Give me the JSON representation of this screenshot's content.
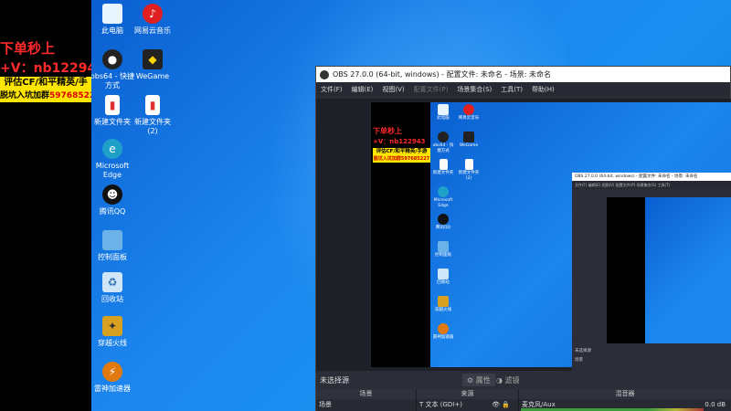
{
  "overlay": {
    "line1": "下单秒上",
    "line2": "+V：nb122943",
    "line3": "评估CF/和平精英/手游",
    "line4_prefix": "脱坑入坑加群",
    "line4_qq": "597685227"
  },
  "desktop_icons": [
    {
      "label": "此电脑",
      "icon": "pc-icon",
      "color": "#e8f4ff"
    },
    {
      "label": "网易云音乐",
      "icon": "netease-music-icon",
      "color": "#e02020"
    },
    {
      "label": "obs64 - 快捷方式",
      "icon": "obs-icon",
      "color": "#222"
    },
    {
      "label": "WeGame",
      "icon": "wegame-icon",
      "color": "#222"
    },
    {
      "label": "新建文件夹",
      "icon": "file-icon",
      "color": "#ffffff"
    },
    {
      "label": "新建文件夹(2)",
      "icon": "file-icon",
      "color": "#ffffff"
    },
    {
      "label": "Microsoft Edge",
      "icon": "edge-icon",
      "color": "#1fa0c8"
    },
    {
      "label": "腾讯QQ",
      "icon": "qq-icon",
      "color": "#111"
    },
    {
      "label": "控制面板",
      "icon": "control-panel-icon",
      "color": "#6bb2e8"
    },
    {
      "label": "回收站",
      "icon": "recycle-bin-icon",
      "color": "#cfe6f8"
    },
    {
      "label": "穿越火线",
      "icon": "crossfire-icon",
      "color": "#d8a020"
    },
    {
      "label": "雷神加速器",
      "icon": "leishen-icon",
      "color": "#e07a10"
    }
  ],
  "obs": {
    "title": "OBS 27.0.0 (64-bit, windows) - 配置文件: 未命名 - 场景: 未命名",
    "menu": [
      "文件(F)",
      "编辑(E)",
      "视图(V)",
      "配置文件(P)",
      "场景集合(S)",
      "工具(T)",
      "帮助(H)"
    ],
    "status_label": "未选择源",
    "props_label": "属性",
    "filters_label": "滤镜",
    "docks": {
      "scenes_header": "场景",
      "scene_item": "场景",
      "sources_header": "来源",
      "source_item": "文本 (GDI+)",
      "mixer_header": "混音器",
      "mixer_item": "麦克风/Aux",
      "mixer_db": "0.0 dB"
    },
    "nested_title": "OBS 27.0.0 (64-bit, windows) - 配置文件: 未命名 - 场景: 未命名",
    "nested_status": "未选择源"
  }
}
